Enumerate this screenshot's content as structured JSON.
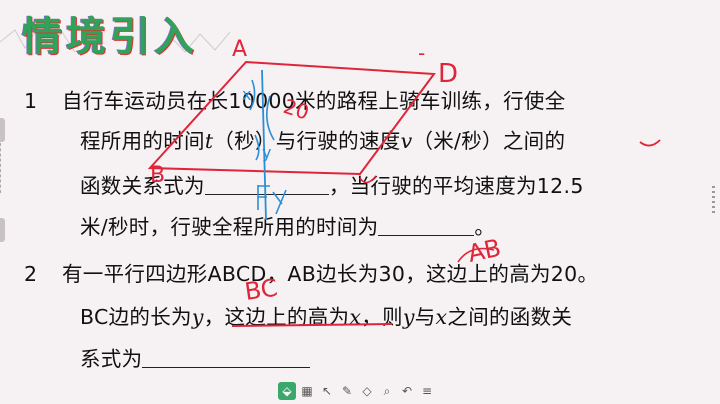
{
  "slide": {
    "title": "情境引入",
    "q1": {
      "number": "1",
      "line1": "自行车运动员在长10000米的路程上骑车训练，行使全",
      "line2_a": "程所用的时间",
      "var_t": "t",
      "line2_b": "（秒）与行驶的速度",
      "var_v": "v",
      "line2_c": "（米/秒）之间的",
      "line3_a": "函数关系式为",
      "line3_b": "，当行驶的平均速度为12.5",
      "line4_a": "米/秒时，行驶全程所用的时间为",
      "line4_b": "。"
    },
    "q2": {
      "number": "2",
      "line1": "有一平行四边形ABCD，AB边长为30，这边上的高为20。",
      "line2_a": "BC边的长为",
      "var_y": "y",
      "line2_b": "，这边上的高为",
      "var_x": "x",
      "line2_c": "，则",
      "var_y2": "y",
      "line2_d": "与",
      "var_x2": "x",
      "line2_e": "之间的函数关",
      "line3_a": "系式为"
    }
  },
  "annotations": {
    "label_A": "A",
    "label_B": "B",
    "label_D": "D",
    "label_AB": "AB",
    "label_BC": "BC",
    "label_20": "20",
    "label_x": "x",
    "label_y": "y",
    "label_dash": "-"
  },
  "toolbar": {
    "icons": [
      "eraser-select-icon",
      "grid-icon",
      "pen-icon",
      "marker-icon",
      "eraser-icon",
      "search-icon",
      "undo-icon",
      "menu-icon"
    ],
    "glyphs": [
      "⬙",
      "▦",
      "↖",
      "✎",
      "◇",
      "⌕",
      "↶",
      "≡"
    ]
  },
  "colors": {
    "title_green": "#2ea35a",
    "ink_red": "#e0253a",
    "ink_blue": "#2b8fd6",
    "tool_active": "#3aa76d"
  }
}
